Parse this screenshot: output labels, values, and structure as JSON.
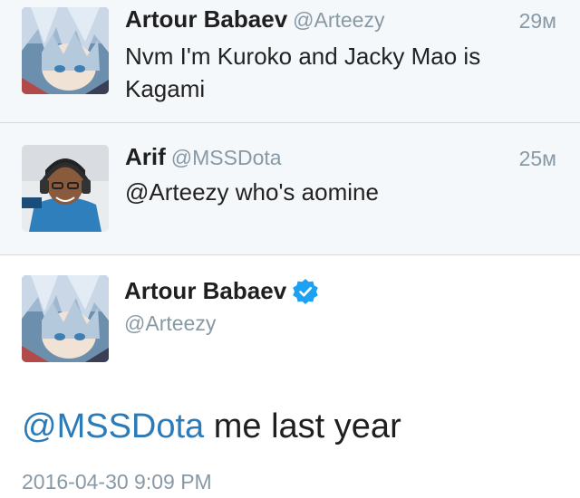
{
  "replies": [
    {
      "name": "Artour Babaev",
      "handle": "@Arteezy",
      "time": "29м",
      "text": "Nvm I'm Kuroko and Jacky Mao is Kagami",
      "avatar_icon": "anime-character-avatar"
    },
    {
      "name": "Arif",
      "handle": "@MSSDota",
      "time": "25м",
      "text": "@Arteezy who's aomine",
      "avatar_icon": "headset-gamer-avatar"
    }
  ],
  "main_tweet": {
    "name": "Artour Babaev",
    "handle": "@Arteezy",
    "verified_icon": "verified-badge-icon",
    "mention": "@MSSDota",
    "text": " me last year",
    "timestamp": "2016-04-30 9:09 PM",
    "avatar_icon": "anime-character-avatar"
  },
  "colors": {
    "link": "#2b7bb9",
    "muted": "#8899a6",
    "reply_bg": "#f5f8fa",
    "verified": "#1da1f2"
  }
}
